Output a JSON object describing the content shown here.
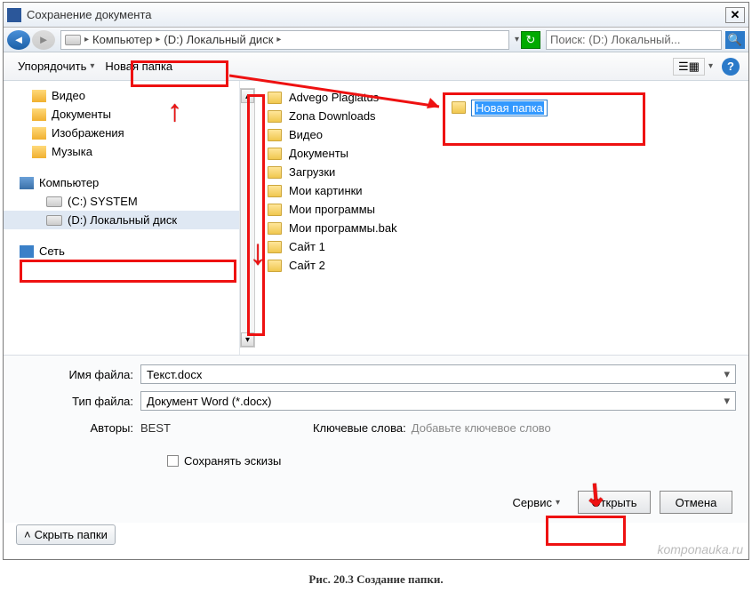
{
  "window": {
    "title": "Сохранение документа",
    "close": "✕"
  },
  "nav": {
    "back": "◄",
    "fwd": "►",
    "crumb1": "Компьютер",
    "crumb2": "(D:) Локальный диск",
    "refresh": "↻",
    "search_placeholder": "Поиск: (D:) Локальный...",
    "search_icon": "🔍"
  },
  "toolbar": {
    "organize": "Упорядочить",
    "new_folder": "Новая папка",
    "view": "☰▦",
    "help": "?"
  },
  "sidebar": {
    "libs": [
      {
        "label": "Видео"
      },
      {
        "label": "Документы"
      },
      {
        "label": "Изображения"
      },
      {
        "label": "Музыка"
      }
    ],
    "computer": "Компьютер",
    "drives": [
      {
        "label": "(C:) SYSTEM"
      },
      {
        "label": "(D:) Локальный диск"
      }
    ],
    "network": "Сеть"
  },
  "files": [
    "Advego Plagiatus",
    "Zona Downloads",
    "Видео",
    "Документы",
    "Загрузки",
    "Мои картинки",
    "Мои программы",
    "Мои программы.bak",
    "Сайт 1",
    "Сайт 2"
  ],
  "new_folder_edit": "Новая папка",
  "form": {
    "filename_label": "Имя файла:",
    "filename_value": "Текст.docx",
    "filetype_label": "Тип файла:",
    "filetype_value": "Документ Word (*.docx)",
    "authors_label": "Авторы:",
    "authors_value": "BEST",
    "keywords_label": "Ключевые слова:",
    "keywords_hint": "Добавьте ключевое слово",
    "save_thumb": "Сохранять эскизы"
  },
  "actions": {
    "hide_folders": "Скрыть папки",
    "service": "Сервис",
    "open": "Открыть",
    "cancel": "Отмена"
  },
  "watermark": "komponauka.ru",
  "caption": "Рис. 20.3 Создание папки."
}
